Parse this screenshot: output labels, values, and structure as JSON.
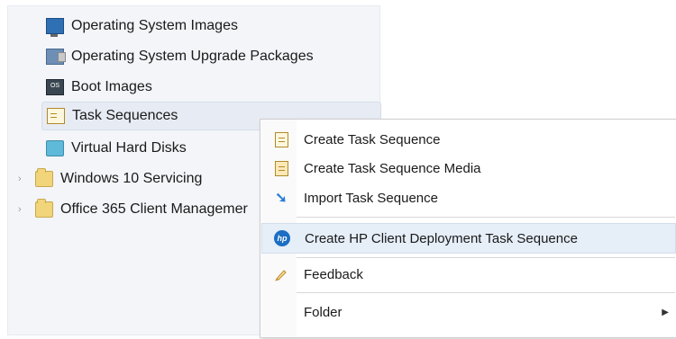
{
  "tree": {
    "items": [
      {
        "label": "Operating System Images",
        "icon": "monitor-icon"
      },
      {
        "label": "Operating System Upgrade Packages",
        "icon": "package-icon"
      },
      {
        "label": "Boot Images",
        "icon": "boot-image-icon"
      },
      {
        "label": "Task Sequences",
        "icon": "task-sequence-icon",
        "selected": true
      },
      {
        "label": "Virtual Hard Disks",
        "icon": "virtual-disk-icon"
      },
      {
        "label": "Windows 10 Servicing",
        "icon": "folder-icon"
      },
      {
        "label": "Office 365 Client Managemer",
        "icon": "folder-icon"
      }
    ]
  },
  "context_menu": {
    "items": [
      {
        "label": "Create Task Sequence",
        "icon": "task-sequence-icon"
      },
      {
        "label": "Create Task Sequence Media",
        "icon": "task-sequence-media-icon"
      },
      {
        "label": "Import Task Sequence",
        "icon": "import-arrow-icon"
      },
      {
        "label": "Create HP Client Deployment Task Sequence",
        "icon": "hp-logo-icon",
        "highlighted": true
      },
      {
        "label": "Feedback",
        "icon": "feedback-icon"
      },
      {
        "label": "Folder",
        "icon": "",
        "submenu": true
      }
    ],
    "hp_logo_text": "hp",
    "boot_icon_text": "OS",
    "submenu_arrow": "▶"
  },
  "colors": {
    "hp_blue": "#1b6ec2",
    "folder_yellow": "#f2d47a",
    "highlight": "#e6eef8"
  }
}
